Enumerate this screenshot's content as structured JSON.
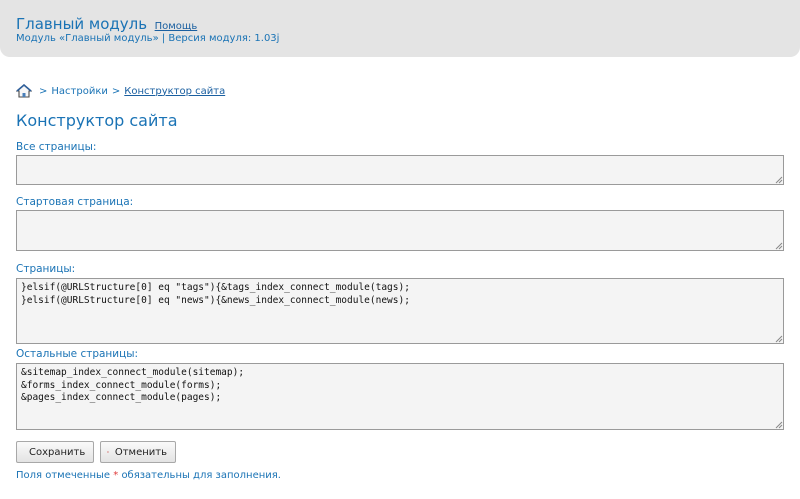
{
  "header": {
    "title": "Главный модуль",
    "help_link": "Помощь",
    "subtitle": "Модуль «Главный модуль» | Версия модуля: 1.03j"
  },
  "breadcrumb": {
    "home_icon": "home-icon",
    "separator": ">",
    "items": [
      "Настройки",
      "Конструктор сайта"
    ]
  },
  "page_title": "Конструктор сайта",
  "fields": [
    {
      "label": "Все страницы:",
      "value": ""
    },
    {
      "label": "Стартовая страница:",
      "value": ""
    },
    {
      "label": "Страницы:",
      "value": "}elsif(@URLStructure[0] eq \"tags\"){&tags_index_connect_module(tags);\n}elsif(@URLStructure[0] eq \"news\"){&news_index_connect_module(news);"
    },
    {
      "label": "Остальные страницы:",
      "value": "&sitemap_index_connect_module(sitemap);\n&forms_index_connect_module(forms);\n&pages_index_connect_module(pages);"
    }
  ],
  "buttons": {
    "save": {
      "label": "Сохранить",
      "icon": "floppy-disk-icon"
    },
    "cancel": {
      "label": "Отменить",
      "icon": "red-x-icon"
    }
  },
  "footnote": {
    "before": "Поля отмеченные",
    "star": "*",
    "after": "обязательны для заполнения."
  },
  "colors": {
    "accent": "#1a73b5",
    "header_bg": "#e4e4e4",
    "field_bg": "#f4f4f4",
    "required_star": "#e03a3a"
  }
}
